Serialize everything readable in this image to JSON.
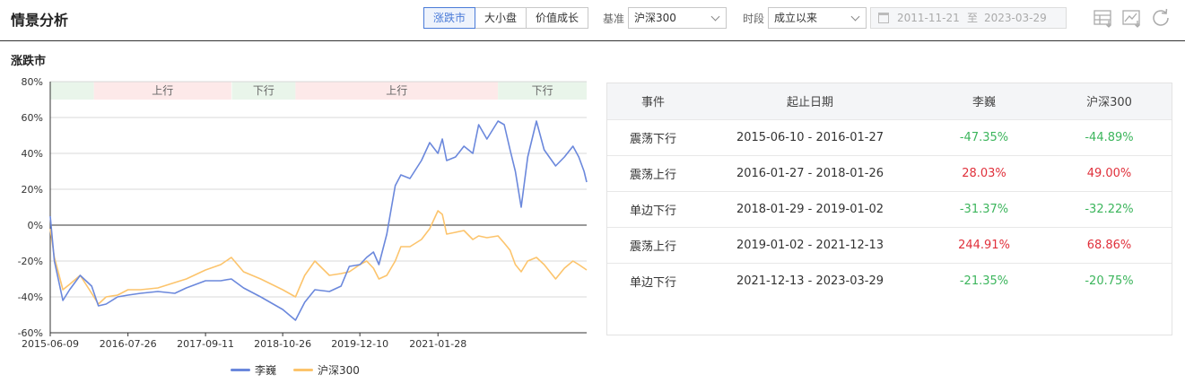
{
  "header": {
    "title": "情景分析",
    "tabs": [
      {
        "label": "涨跌市",
        "active": true
      },
      {
        "label": "大小盘",
        "active": false
      },
      {
        "label": "价值成长",
        "active": false
      }
    ],
    "benchmark": {
      "label": "基准",
      "value": "沪深300"
    },
    "period": {
      "label": "时段",
      "value": "成立以来"
    },
    "date_range": {
      "start": "2011-11-21",
      "to": "至",
      "end": "2023-03-29"
    },
    "tools": [
      "table-download-icon",
      "chart-download-icon",
      "refresh-icon"
    ]
  },
  "section": {
    "title": "涨跌市"
  },
  "colors": {
    "fund": "#6b88dc",
    "benchmark": "#fcc46c",
    "up_band": "#fde9e9",
    "down_band": "#e9f5ea",
    "positive": "#e0303b",
    "negative": "#3cb55c",
    "active_tab": "#4a7bd8"
  },
  "chart_data": {
    "type": "line",
    "ylim": [
      -60,
      80
    ],
    "y_ticks": [
      "80%",
      "60%",
      "40%",
      "20%",
      "0%",
      "-20%",
      "-40%",
      "-60%"
    ],
    "x_ticks": [
      "2015-06-09",
      "2016-07-26",
      "2017-09-11",
      "2018-10-26",
      "2019-12-10",
      "2021-01-28"
    ],
    "x_range": [
      "2015-06-09",
      "2023-03-29"
    ],
    "bands": [
      {
        "label": "",
        "start": "2015-06-10",
        "end": "2016-01-27",
        "kind": "down"
      },
      {
        "label": "上行",
        "start": "2016-01-27",
        "end": "2018-01-26",
        "kind": "up"
      },
      {
        "label": "下行",
        "start": "2018-01-29",
        "end": "2019-01-02",
        "kind": "down"
      },
      {
        "label": "上行",
        "start": "2019-01-02",
        "end": "2021-12-13",
        "kind": "up"
      },
      {
        "label": "下行",
        "start": "2021-12-13",
        "end": "2023-03-29",
        "kind": "down"
      }
    ],
    "series": [
      {
        "name": "李巍",
        "color": "#6b88dc",
        "points": [
          [
            "2015-06-09",
            5
          ],
          [
            "2015-07-01",
            -20
          ],
          [
            "2015-08-15",
            -42
          ],
          [
            "2015-09-20",
            -36
          ],
          [
            "2015-11-15",
            -28
          ],
          [
            "2016-01-15",
            -34
          ],
          [
            "2016-02-20",
            -45
          ],
          [
            "2016-04-01",
            -44
          ],
          [
            "2016-06-01",
            -40
          ],
          [
            "2016-07-26",
            -39
          ],
          [
            "2016-10-01",
            -38
          ],
          [
            "2017-01-01",
            -37
          ],
          [
            "2017-04-01",
            -38
          ],
          [
            "2017-06-01",
            -35
          ],
          [
            "2017-09-11",
            -31
          ],
          [
            "2017-12-01",
            -31
          ],
          [
            "2018-01-26",
            -30
          ],
          [
            "2018-04-01",
            -35
          ],
          [
            "2018-07-01",
            -40
          ],
          [
            "2018-10-26",
            -47
          ],
          [
            "2019-01-02",
            -53
          ],
          [
            "2019-02-20",
            -43
          ],
          [
            "2019-04-15",
            -36
          ],
          [
            "2019-07-01",
            -37
          ],
          [
            "2019-09-01",
            -34
          ],
          [
            "2019-10-15",
            -23
          ],
          [
            "2019-12-10",
            -22
          ],
          [
            "2020-01-15",
            -18
          ],
          [
            "2020-02-20",
            -15
          ],
          [
            "2020-03-20",
            -22
          ],
          [
            "2020-05-01",
            -5
          ],
          [
            "2020-06-15",
            22
          ],
          [
            "2020-07-15",
            28
          ],
          [
            "2020-09-01",
            26
          ],
          [
            "2020-11-01",
            36
          ],
          [
            "2020-12-15",
            46
          ],
          [
            "2021-01-28",
            40
          ],
          [
            "2021-02-20",
            48
          ],
          [
            "2021-03-15",
            36
          ],
          [
            "2021-05-01",
            38
          ],
          [
            "2021-06-15",
            44
          ],
          [
            "2021-08-01",
            40
          ],
          [
            "2021-09-01",
            56
          ],
          [
            "2021-10-15",
            48
          ],
          [
            "2021-12-13",
            58
          ],
          [
            "2022-01-15",
            56
          ],
          [
            "2022-02-15",
            42
          ],
          [
            "2022-03-15",
            30
          ],
          [
            "2022-04-15",
            10
          ],
          [
            "2022-05-20",
            38
          ],
          [
            "2022-07-05",
            58
          ],
          [
            "2022-08-15",
            42
          ],
          [
            "2022-10-15",
            33
          ],
          [
            "2022-12-01",
            38
          ],
          [
            "2023-01-15",
            44
          ],
          [
            "2023-02-15",
            38
          ],
          [
            "2023-03-15",
            30
          ],
          [
            "2023-03-29",
            24
          ]
        ]
      },
      {
        "name": "沪深300",
        "color": "#fcc46c",
        "points": [
          [
            "2015-06-09",
            -2
          ],
          [
            "2015-07-01",
            -18
          ],
          [
            "2015-08-15",
            -36
          ],
          [
            "2015-09-20",
            -33
          ],
          [
            "2015-11-15",
            -28
          ],
          [
            "2016-01-15",
            -38
          ],
          [
            "2016-02-20",
            -44
          ],
          [
            "2016-04-01",
            -40
          ],
          [
            "2016-06-01",
            -39
          ],
          [
            "2016-07-26",
            -36
          ],
          [
            "2016-10-01",
            -36
          ],
          [
            "2017-01-01",
            -35
          ],
          [
            "2017-04-01",
            -32
          ],
          [
            "2017-06-01",
            -30
          ],
          [
            "2017-09-11",
            -25
          ],
          [
            "2017-12-01",
            -22
          ],
          [
            "2018-01-26",
            -18
          ],
          [
            "2018-04-01",
            -26
          ],
          [
            "2018-07-01",
            -30
          ],
          [
            "2018-10-26",
            -36
          ],
          [
            "2019-01-02",
            -40
          ],
          [
            "2019-02-20",
            -28
          ],
          [
            "2019-04-15",
            -20
          ],
          [
            "2019-07-01",
            -28
          ],
          [
            "2019-09-01",
            -27
          ],
          [
            "2019-10-15",
            -26
          ],
          [
            "2019-12-10",
            -22
          ],
          [
            "2020-01-15",
            -20
          ],
          [
            "2020-02-20",
            -24
          ],
          [
            "2020-03-20",
            -30
          ],
          [
            "2020-05-01",
            -28
          ],
          [
            "2020-06-15",
            -20
          ],
          [
            "2020-07-15",
            -12
          ],
          [
            "2020-09-01",
            -12
          ],
          [
            "2020-11-01",
            -8
          ],
          [
            "2020-12-15",
            -2
          ],
          [
            "2021-01-28",
            8
          ],
          [
            "2021-02-20",
            6
          ],
          [
            "2021-03-15",
            -5
          ],
          [
            "2021-05-01",
            -4
          ],
          [
            "2021-06-15",
            -3
          ],
          [
            "2021-08-01",
            -8
          ],
          [
            "2021-09-01",
            -6
          ],
          [
            "2021-10-15",
            -7
          ],
          [
            "2021-12-13",
            -6
          ],
          [
            "2022-01-15",
            -10
          ],
          [
            "2022-02-15",
            -14
          ],
          [
            "2022-03-15",
            -22
          ],
          [
            "2022-04-15",
            -26
          ],
          [
            "2022-05-20",
            -20
          ],
          [
            "2022-07-05",
            -18
          ],
          [
            "2022-08-15",
            -22
          ],
          [
            "2022-10-15",
            -30
          ],
          [
            "2022-12-01",
            -24
          ],
          [
            "2023-01-15",
            -20
          ],
          [
            "2023-02-15",
            -22
          ],
          [
            "2023-03-15",
            -24
          ],
          [
            "2023-03-29",
            -25
          ]
        ]
      }
    ]
  },
  "legend": [
    {
      "name": "李巍",
      "color": "#6b88dc"
    },
    {
      "name": "沪深300",
      "color": "#fcc46c"
    }
  ],
  "table": {
    "headers": [
      "事件",
      "起止日期",
      "李巍",
      "沪深300"
    ],
    "rows": [
      {
        "event": "震荡下行",
        "range": "2015-06-10 - 2016-01-27",
        "fund": "-47.35%",
        "fund_sign": "neg",
        "bench": "-44.89%",
        "bench_sign": "neg"
      },
      {
        "event": "震荡上行",
        "range": "2016-01-27 - 2018-01-26",
        "fund": "28.03%",
        "fund_sign": "pos",
        "bench": "49.00%",
        "bench_sign": "pos"
      },
      {
        "event": "单边下行",
        "range": "2018-01-29 - 2019-01-02",
        "fund": "-31.37%",
        "fund_sign": "neg",
        "bench": "-32.22%",
        "bench_sign": "neg"
      },
      {
        "event": "震荡上行",
        "range": "2019-01-02 - 2021-12-13",
        "fund": "244.91%",
        "fund_sign": "pos",
        "bench": "68.86%",
        "bench_sign": "pos"
      },
      {
        "event": "单边下行",
        "range": "2021-12-13 - 2023-03-29",
        "fund": "-21.35%",
        "fund_sign": "neg",
        "bench": "-20.75%",
        "bench_sign": "neg"
      }
    ]
  }
}
